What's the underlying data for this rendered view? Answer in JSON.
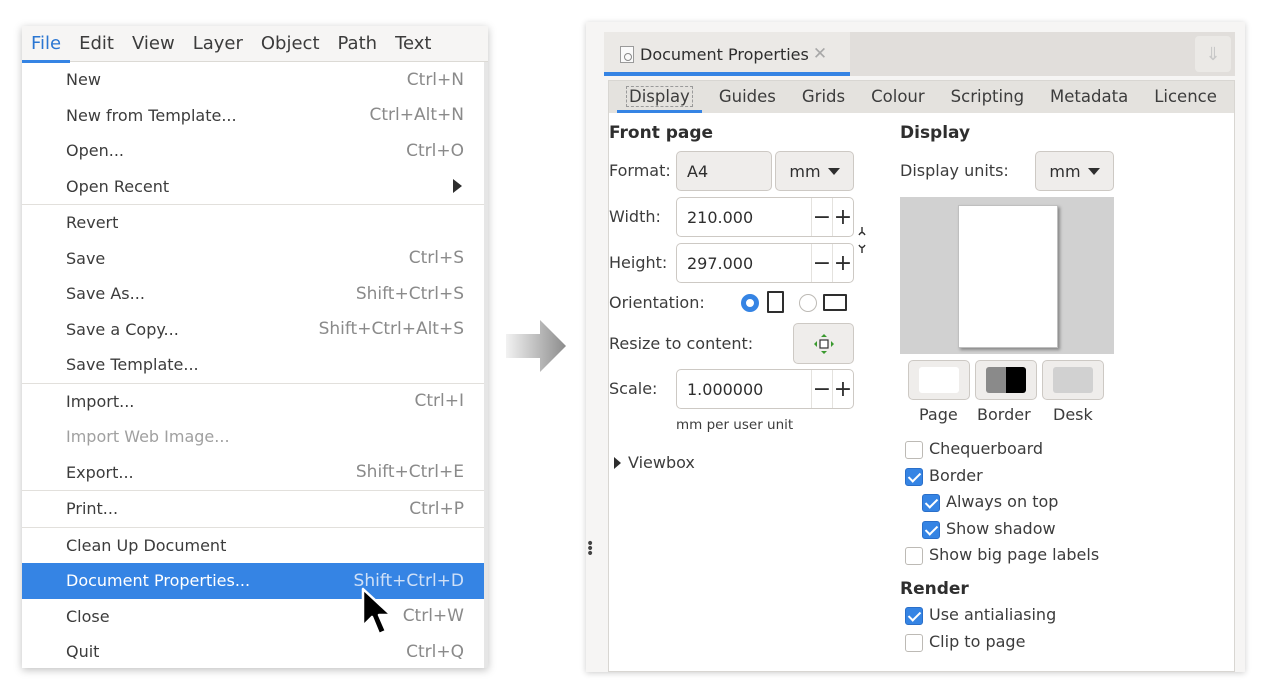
{
  "menubar": {
    "items": [
      "File",
      "Edit",
      "View",
      "Layer",
      "Object",
      "Path",
      "Text"
    ],
    "active": "File"
  },
  "file_menu": {
    "groups": [
      [
        {
          "label": "New",
          "shortcut": "Ctrl+N"
        },
        {
          "label": "New from Template...",
          "shortcut": "Ctrl+Alt+N"
        },
        {
          "label": "Open...",
          "shortcut": "Ctrl+O"
        },
        {
          "label": "Open Recent",
          "shortcut": "",
          "submenu": true
        }
      ],
      [
        {
          "label": "Revert",
          "shortcut": ""
        },
        {
          "label": "Save",
          "shortcut": "Ctrl+S"
        },
        {
          "label": "Save As...",
          "shortcut": "Shift+Ctrl+S"
        },
        {
          "label": "Save a Copy...",
          "shortcut": "Shift+Ctrl+Alt+S"
        },
        {
          "label": "Save Template...",
          "shortcut": ""
        }
      ],
      [
        {
          "label": "Import...",
          "shortcut": "Ctrl+I"
        },
        {
          "label": "Import Web Image...",
          "shortcut": "",
          "disabled": true
        },
        {
          "label": "Export...",
          "shortcut": "Shift+Ctrl+E"
        }
      ],
      [
        {
          "label": "Print...",
          "shortcut": "Ctrl+P"
        }
      ],
      [
        {
          "label": "Clean Up Document",
          "shortcut": ""
        },
        {
          "label": "Document Properties...",
          "shortcut": "Shift+Ctrl+D",
          "highlighted": true
        },
        {
          "label": "Close",
          "shortcut": "Ctrl+W"
        },
        {
          "label": "Quit",
          "shortcut": "Ctrl+Q"
        }
      ]
    ]
  },
  "dialog": {
    "dock_tab_title": "Document Properties",
    "tabs": [
      "Display",
      "Guides",
      "Grids",
      "Colour",
      "Scripting",
      "Metadata",
      "Licence"
    ],
    "active_tab": "Display",
    "front_page": {
      "title": "Front page",
      "format_label": "Format:",
      "format_value": "A4",
      "format_unit": "mm",
      "width_label": "Width:",
      "width_value": "210.000",
      "height_label": "Height:",
      "height_value": "297.000",
      "orientation_label": "Orientation:",
      "orientation_selected": "portrait",
      "resize_label": "Resize to content:",
      "scale_label": "Scale:",
      "scale_value": "1.000000",
      "scale_hint": "mm per user unit",
      "viewbox_label": "Viewbox"
    },
    "display": {
      "title": "Display",
      "units_label": "Display units:",
      "units_value": "mm",
      "swatches": [
        {
          "label": "Page",
          "color": "#ffffff"
        },
        {
          "label": "Border",
          "color": "#000000"
        },
        {
          "label": "Desk",
          "color": "#d1d1d1"
        }
      ],
      "checkboxes": [
        {
          "label": "Chequerboard",
          "checked": false,
          "indent": false
        },
        {
          "label": "Border",
          "checked": true,
          "indent": false
        },
        {
          "label": "Always on top",
          "checked": true,
          "indent": true
        },
        {
          "label": "Show shadow",
          "checked": true,
          "indent": true
        },
        {
          "label": "Show big page labels",
          "checked": false,
          "indent": false
        }
      ]
    },
    "render": {
      "title": "Render",
      "checkboxes": [
        {
          "label": "Use antialiasing",
          "checked": true
        },
        {
          "label": "Clip to page",
          "checked": false
        }
      ]
    }
  },
  "colors": {
    "accent": "#3584e4"
  }
}
